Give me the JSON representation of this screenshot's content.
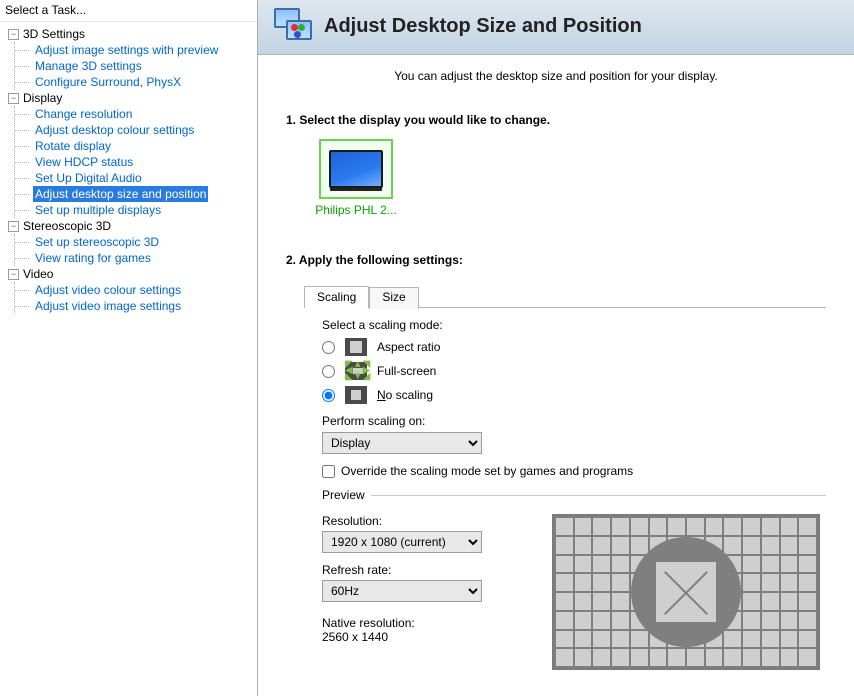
{
  "sidebar": {
    "header": "Select a Task...",
    "groups": [
      {
        "label": "3D Settings",
        "items": [
          "Adjust image settings with preview",
          "Manage 3D settings",
          "Configure Surround, PhysX"
        ]
      },
      {
        "label": "Display",
        "items": [
          "Change resolution",
          "Adjust desktop colour settings",
          "Rotate display",
          "View HDCP status",
          "Set Up Digital Audio",
          "Adjust desktop size and position",
          "Set up multiple displays"
        ],
        "selected_index": 5
      },
      {
        "label": "Stereoscopic 3D",
        "items": [
          "Set up stereoscopic 3D",
          "View rating for games"
        ]
      },
      {
        "label": "Video",
        "items": [
          "Adjust video colour settings",
          "Adjust video image settings"
        ]
      }
    ]
  },
  "title": "Adjust Desktop Size and Position",
  "description": "You can adjust the desktop size and position for your display.",
  "step1": {
    "heading": "1. Select the display you would like to change.",
    "display_label": "Philips PHL 2..."
  },
  "step2": {
    "heading": "2. Apply the following settings:",
    "tabs": {
      "scaling": "Scaling",
      "size": "Size"
    },
    "scaling_mode_label": "Select a scaling mode:",
    "modes": {
      "aspect": "Aspect ratio",
      "full": "Full-screen",
      "none": "No scaling"
    },
    "perform_on_label": "Perform scaling on:",
    "perform_on_value": "Display",
    "override_label": "Override the scaling mode set by games and programs",
    "preview_legend": "Preview",
    "resolution_label": "Resolution:",
    "resolution_value": "1920 x 1080 (current)",
    "refresh_label": "Refresh rate:",
    "refresh_value": "60Hz",
    "native_label": "Native resolution:",
    "native_value": "2560 x 1440"
  }
}
